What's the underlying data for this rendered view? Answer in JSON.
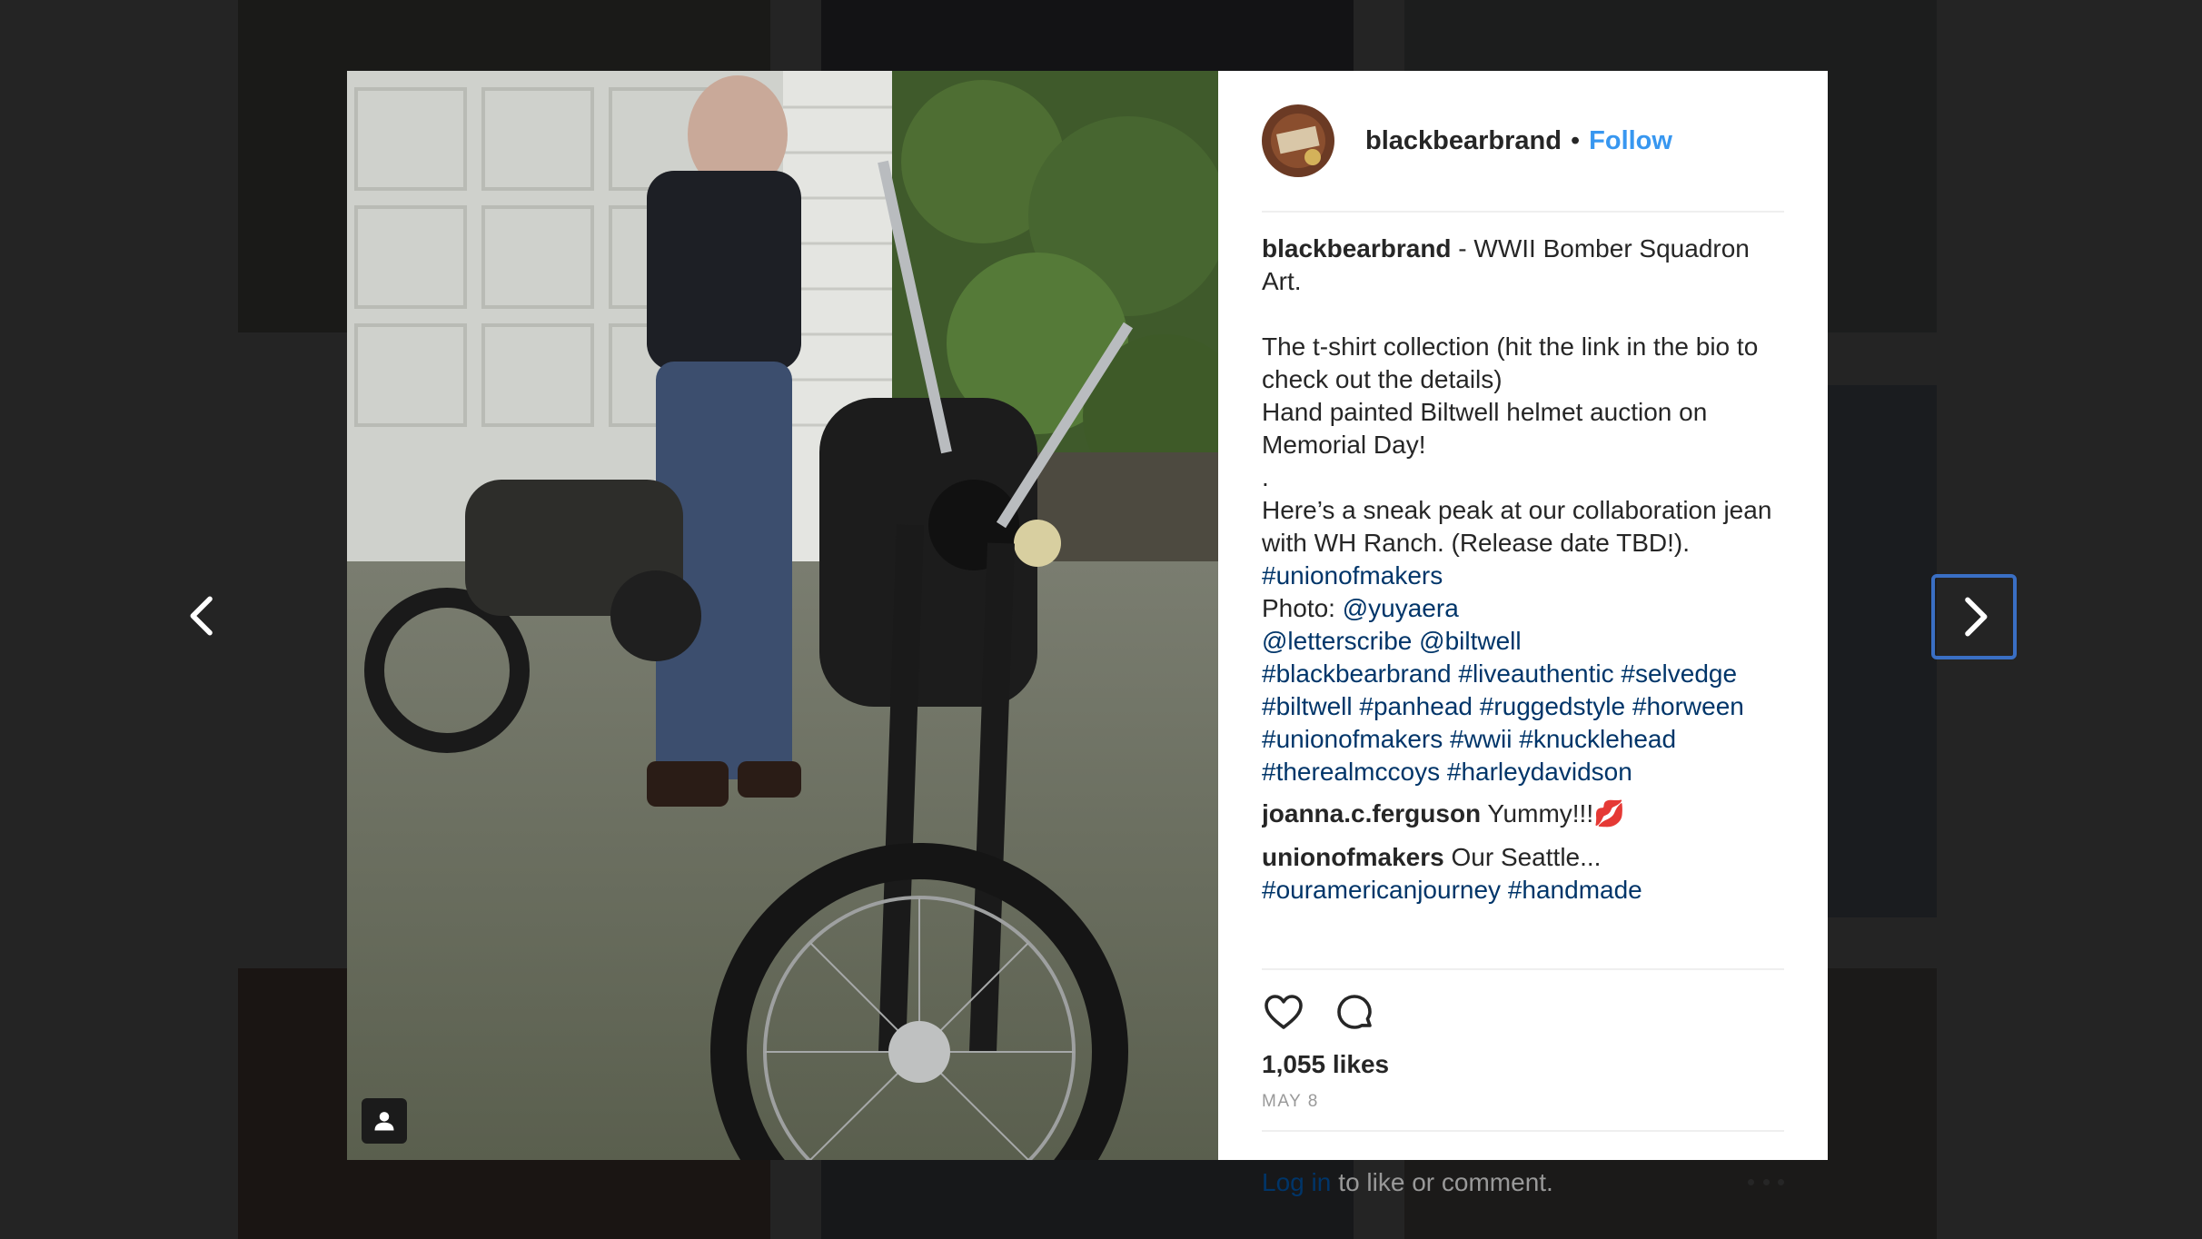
{
  "post": {
    "username": "blackbearbrand",
    "separator": "•",
    "follow_label": "Follow",
    "caption_user": "blackbearbrand",
    "caption_lines": [
      " - WWII Bomber Squadron Art.",
      "",
      "The t-shirt collection (hit the link in the bio to check out the details)",
      "Hand painted Biltwell helmet auction on Memorial Day!",
      ".",
      "Here’s a sneak peak at our collaboration jean with WH Ranch. (Release date TBD!)."
    ],
    "tags_line1": "#unionofmakers",
    "photo_label": "Photo: ",
    "photo_mention": "@yuyaera",
    "mentions": [
      "@letterscribe",
      "@biltwell"
    ],
    "hashtags": [
      "#blackbearbrand",
      "#liveauthentic",
      "#selvedge",
      "#biltwell",
      "#panhead",
      "#ruggedstyle",
      "#horween",
      "#unionofmakers",
      "#wwii",
      "#knucklehead",
      "#therealmccoys",
      "#harleydavidson"
    ],
    "comments": [
      {
        "user": "joanna.c.ferguson",
        "text": " Yummy!!!💋"
      },
      {
        "user": "unionofmakers",
        "text": " Our Seattle...",
        "tags": [
          "#ouramericanjourney",
          "#handmade"
        ]
      }
    ],
    "likes": "1,055 likes",
    "date": "MAY 8",
    "login_link": "Log in",
    "login_rest": "to like or comment."
  },
  "icons": {
    "prev": "chevron-left-icon",
    "next": "chevron-right-icon",
    "like": "heart-icon",
    "comment": "comment-bubble-icon",
    "tag": "person-tag-icon",
    "more": "more-dots-icon"
  },
  "colors": {
    "link_blue": "#003569",
    "follow_blue": "#3897f0",
    "focus_border": "#3a6fc4"
  }
}
